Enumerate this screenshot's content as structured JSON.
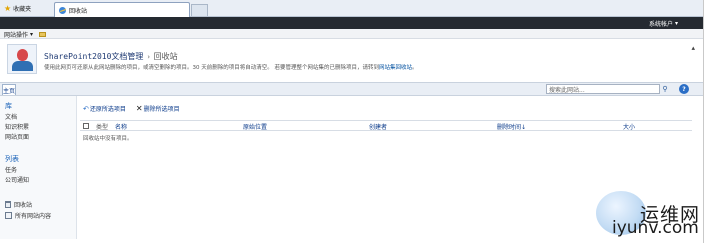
{
  "browser": {
    "favorites_label": "收藏夹",
    "tab_label": "回收站"
  },
  "ribbon": {
    "system_account": "系统帐户",
    "site_actions": "网站操作"
  },
  "title_area": {
    "site_name": "SharePoint2010文档管理",
    "separator": "›",
    "page_name": "回收站",
    "description_prefix": "使用此网页可还原从此网站删除的项目，或清空删除的项目。30 天前删除的项目将自动清空。 若要管理整个网站集的已删除项目，请转到",
    "description_link": "网站集回收站",
    "description_suffix": "。"
  },
  "top_nav": {
    "home_tab": "主页",
    "search_placeholder": "搜索此网站...",
    "help_label": "?"
  },
  "left_nav": {
    "libraries_header": "库",
    "libraries": [
      "文档",
      "知识积累",
      "网站页面"
    ],
    "lists_header": "列表",
    "lists": [
      "任务",
      "公司通知"
    ],
    "recycle_bin": "回收站",
    "all_site_content": "所有网站内容"
  },
  "toolbar": {
    "restore_label": "还原所选项目",
    "delete_label": "删除所选项目"
  },
  "table": {
    "columns": [
      "类型",
      "名称",
      "原始位置",
      "创建者",
      "删除时间",
      "大小"
    ],
    "sort_indicator": "↓",
    "empty_message": "回收站中没有项目。"
  },
  "watermark": {
    "cn": "运维网",
    "en": "iyunv.com"
  }
}
